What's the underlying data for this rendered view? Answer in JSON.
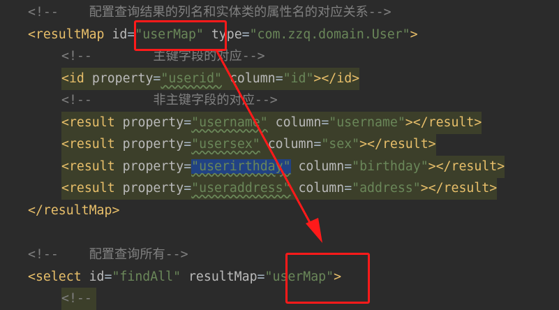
{
  "editor": {
    "comment_map": "<!--    配置查询结果的列名和实体类的属性名的对应关系-->",
    "resultmap_open": {
      "lt": "<",
      "tag": "resultMap",
      "attr_id": "id",
      "eq": "=",
      "val_id": "\"userMap\"",
      "attr_type": "type",
      "val_type": "\"com.zzq.domain.User\"",
      "gt": ">"
    },
    "comment_pk": "<!--        主键字段的对应-->",
    "id_line": {
      "open": "<id",
      "attr_property": "property",
      "val_property": "\"userid\"",
      "attr_column": "column",
      "val_column": "\"id\"",
      "close": "></id>"
    },
    "comment_nonpk": "<!--        非主键字段的对应-->",
    "results": [
      {
        "open": "<result",
        "attr_property": "property",
        "val_property": "\"username\"",
        "attr_column": "column",
        "val_column": "\"username\"",
        "close": "></result>"
      },
      {
        "open": "<result",
        "attr_property": "property",
        "val_property": "\"usersex\"",
        "attr_column": "column",
        "val_column": "\"sex\"",
        "close": "></result>"
      },
      {
        "open": "<result",
        "attr_property": "property",
        "val_property": "\"userirthday\"",
        "attr_column": "column",
        "val_column": "\"birthday\"",
        "close": "></result>"
      },
      {
        "open": "<result",
        "attr_property": "property",
        "val_property": "\"useraddress\"",
        "attr_column": "column",
        "val_column": "\"address\"",
        "close": "></result>"
      }
    ],
    "resultmap_close": "</resultMap>",
    "comment_findall": "<!--    配置查询所有-->",
    "select_line": {
      "open": "<select",
      "attr_id": "id",
      "val_id": "\"findAll\"",
      "attr_resultmap": "resultMap",
      "val_resultmap": "\"userMap\"",
      "gt": ">"
    },
    "comment_partial": "<!--"
  },
  "colors": {
    "background": "#2b2b2b",
    "tag": "#e8bf6a",
    "attribute": "#bababa",
    "string": "#6a8759",
    "comment": "#808080",
    "annotation": "#ff1a1a"
  }
}
